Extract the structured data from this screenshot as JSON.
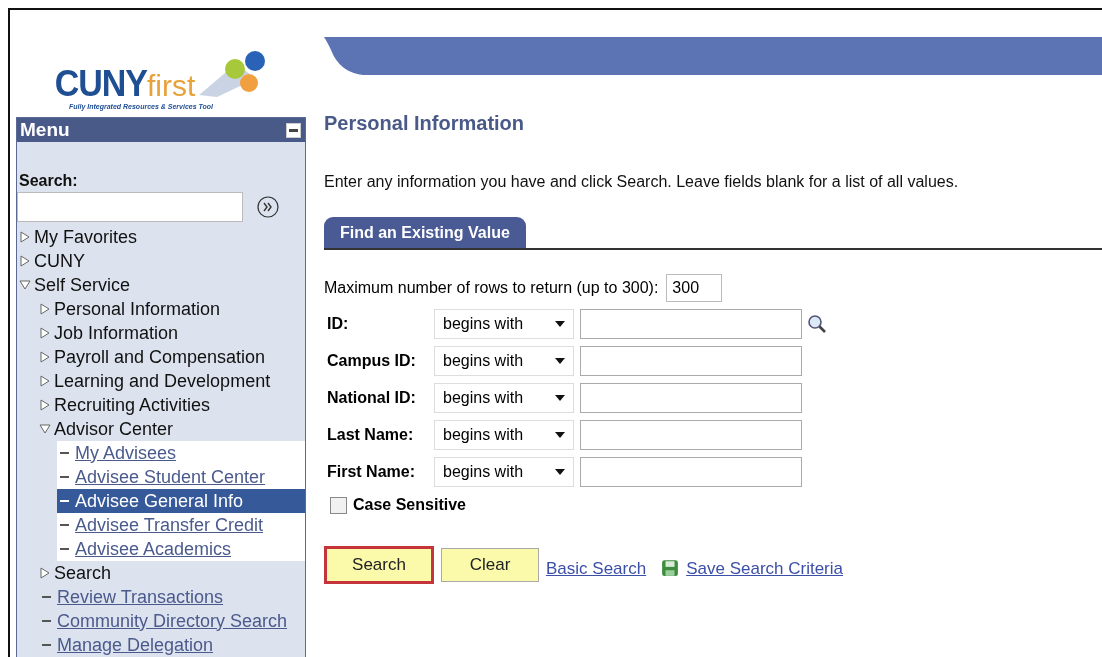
{
  "logo": {
    "primary": "CUNY",
    "secondary": "first",
    "tagline": "Fully Integrated Resources & Services Tool"
  },
  "menu": {
    "title": "Menu",
    "search_label": "Search:",
    "items": [
      {
        "kind": "folder",
        "label": "My Favorites",
        "expanded": false
      },
      {
        "kind": "folder",
        "label": "CUNY",
        "expanded": false
      },
      {
        "kind": "folder",
        "label": "Self Service",
        "expanded": true,
        "children": [
          {
            "kind": "folder",
            "label": "Personal Information",
            "expanded": false
          },
          {
            "kind": "folder",
            "label": "Job Information",
            "expanded": false
          },
          {
            "kind": "folder",
            "label": "Payroll and Compensation",
            "expanded": false
          },
          {
            "kind": "folder",
            "label": "Learning and Development",
            "expanded": false
          },
          {
            "kind": "folder",
            "label": "Recruiting Activities",
            "expanded": false
          },
          {
            "kind": "folder",
            "label": "Advisor Center",
            "expanded": true,
            "children": [
              {
                "kind": "link",
                "label": "My Advisees",
                "selected": false
              },
              {
                "kind": "link",
                "label": "Advisee Student Center",
                "selected": false
              },
              {
                "kind": "link",
                "label": "Advisee General Info",
                "selected": true
              },
              {
                "kind": "link",
                "label": "Advisee Transfer Credit",
                "selected": false
              },
              {
                "kind": "link",
                "label": "Advisee Academics",
                "selected": false
              }
            ]
          },
          {
            "kind": "folder",
            "label": "Search",
            "expanded": false
          },
          {
            "kind": "link",
            "label": "Review Transactions",
            "selected": false
          },
          {
            "kind": "link",
            "label": "Community Directory Search",
            "selected": false
          },
          {
            "kind": "link",
            "label": "Manage Delegation",
            "selected": false
          }
        ]
      }
    ]
  },
  "page": {
    "title": "Personal Information",
    "instructions": "Enter any information you have and click Search. Leave fields blank for a list of all values.",
    "tabs": [
      {
        "label": "Find an Existing Value",
        "selected": true
      }
    ],
    "max_rows": {
      "label": "Maximum number of rows to return (up to 300):",
      "value": "300"
    },
    "fields": [
      {
        "label": "ID:",
        "operator": "begins with",
        "lookup": true
      },
      {
        "label": "Campus ID:",
        "operator": "begins with",
        "lookup": false
      },
      {
        "label": "National ID:",
        "operator": "begins with",
        "lookup": false
      },
      {
        "label": "Last Name:",
        "operator": "begins with",
        "lookup": false
      },
      {
        "label": "First Name:",
        "operator": "begins with",
        "lookup": false
      }
    ],
    "case_sensitive": {
      "label": "Case Sensitive",
      "checked": false
    },
    "buttons": [
      {
        "label": "Search",
        "highlighted": true
      },
      {
        "label": "Clear",
        "highlighted": false
      }
    ],
    "links": [
      {
        "label": "Basic Search",
        "kind": "plain"
      },
      {
        "label": "Save Search Criteria",
        "kind": "save"
      }
    ]
  }
}
